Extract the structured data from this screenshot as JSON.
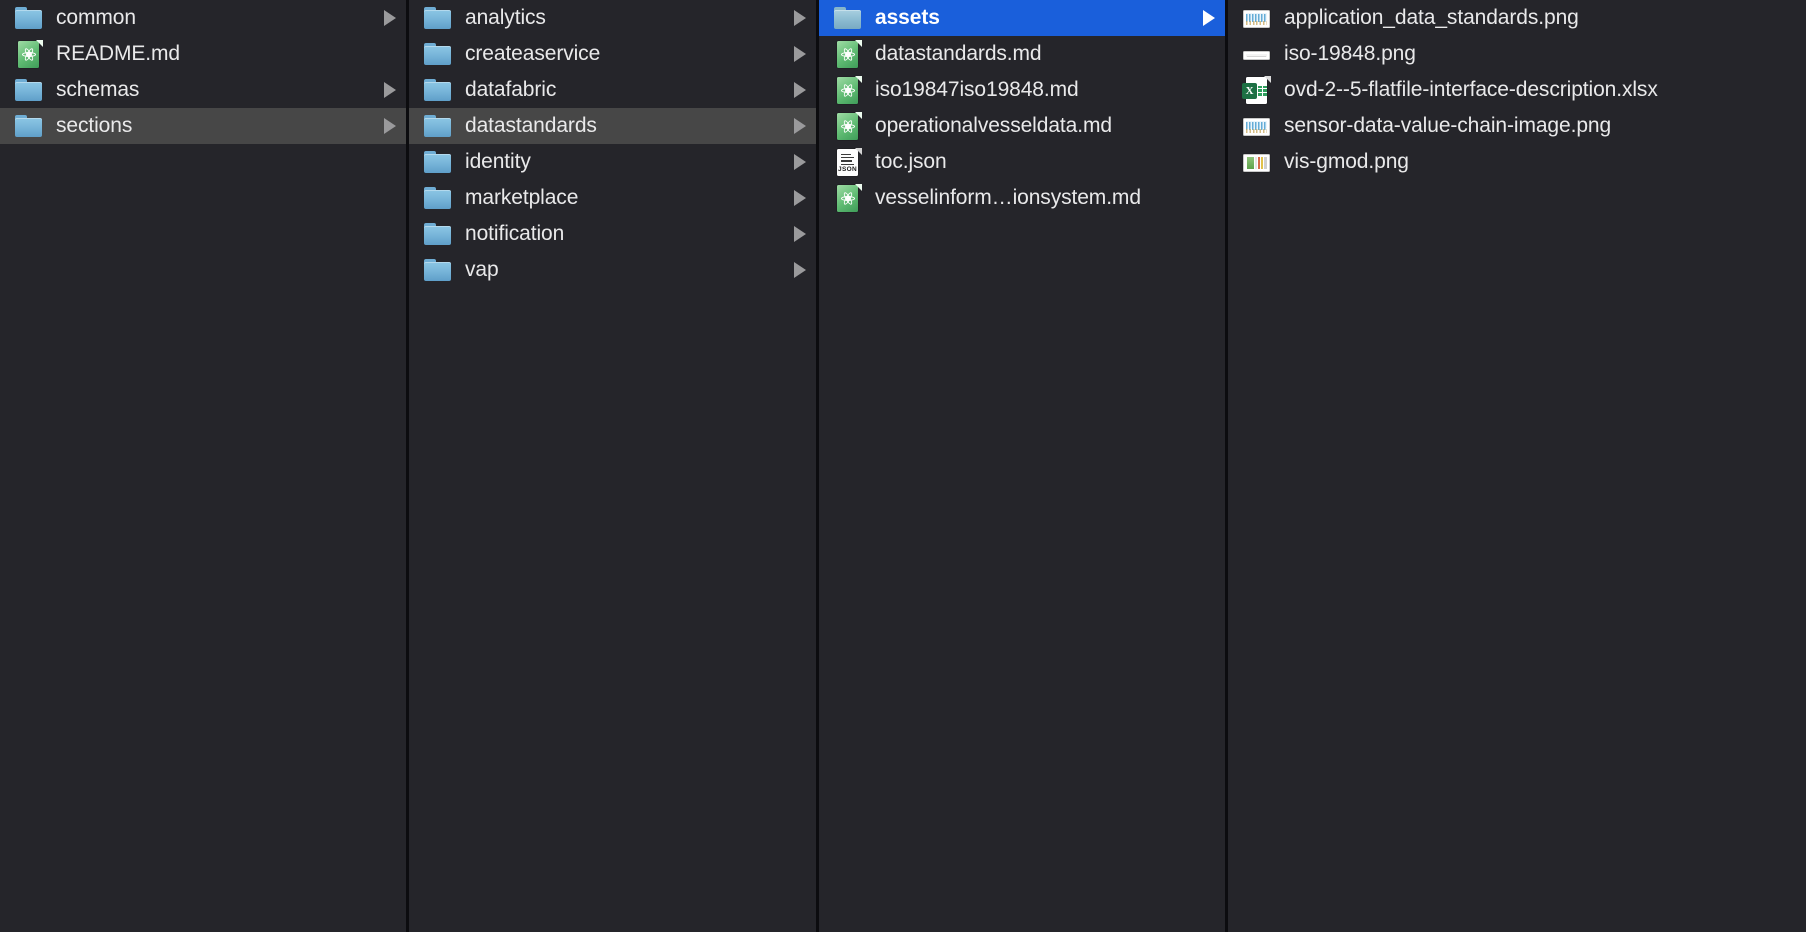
{
  "view": {
    "kind": "finder-column-view",
    "background_color": "#25252a",
    "divider_color": "#0c0c0f",
    "text_color": "#e9e9ea",
    "selection_active_color": "#1a5fdb",
    "selection_inactive_color": "#474747"
  },
  "columns": [
    {
      "name": "column-1",
      "items": [
        {
          "label": "common",
          "icon": "folder-icon",
          "has_chevron": true,
          "selected": "none"
        },
        {
          "label": "README.md",
          "icon": "markdown-icon",
          "has_chevron": false,
          "selected": "none"
        },
        {
          "label": "schemas",
          "icon": "folder-icon",
          "has_chevron": true,
          "selected": "none"
        },
        {
          "label": "sections",
          "icon": "folder-icon",
          "has_chevron": true,
          "selected": "inactive"
        }
      ]
    },
    {
      "name": "column-2",
      "items": [
        {
          "label": "analytics",
          "icon": "folder-icon",
          "has_chevron": true,
          "selected": "none"
        },
        {
          "label": "createaservice",
          "icon": "folder-icon",
          "has_chevron": true,
          "selected": "none"
        },
        {
          "label": "datafabric",
          "icon": "folder-icon",
          "has_chevron": true,
          "selected": "none"
        },
        {
          "label": "datastandards",
          "icon": "folder-icon",
          "has_chevron": true,
          "selected": "inactive"
        },
        {
          "label": "identity",
          "icon": "folder-icon",
          "has_chevron": true,
          "selected": "none"
        },
        {
          "label": "marketplace",
          "icon": "folder-icon",
          "has_chevron": true,
          "selected": "none"
        },
        {
          "label": "notification",
          "icon": "folder-icon",
          "has_chevron": true,
          "selected": "none"
        },
        {
          "label": "vap",
          "icon": "folder-icon",
          "has_chevron": true,
          "selected": "none"
        }
      ]
    },
    {
      "name": "column-3",
      "items": [
        {
          "label": "assets",
          "icon": "folder-icon",
          "has_chevron": true,
          "selected": "active"
        },
        {
          "label": "datastandards.md",
          "icon": "markdown-icon",
          "has_chevron": false,
          "selected": "none"
        },
        {
          "label": "iso19847iso19848.md",
          "icon": "markdown-icon",
          "has_chevron": false,
          "selected": "none"
        },
        {
          "label": "operationalvesseldata.md",
          "icon": "markdown-icon",
          "has_chevron": false,
          "selected": "none"
        },
        {
          "label": "toc.json",
          "icon": "json-icon",
          "has_chevron": false,
          "selected": "none"
        },
        {
          "label": "vesselinform…ionsystem.md",
          "icon": "markdown-icon",
          "has_chevron": false,
          "selected": "none"
        }
      ]
    },
    {
      "name": "column-4",
      "items": [
        {
          "label": "application_data_standards.png",
          "icon": "png-chart-icon",
          "has_chevron": false,
          "selected": "none"
        },
        {
          "label": "iso-19848.png",
          "icon": "png-bar-icon",
          "has_chevron": false,
          "selected": "none"
        },
        {
          "label": "ovd-2--5-flatfile-interface-description.xlsx",
          "icon": "xlsx-icon",
          "has_chevron": false,
          "selected": "none"
        },
        {
          "label": "sensor-data-value-chain-image.png",
          "icon": "png-chart-icon",
          "has_chevron": false,
          "selected": "none"
        },
        {
          "label": "vis-gmod.png",
          "icon": "png-color-icon",
          "has_chevron": false,
          "selected": "none"
        }
      ]
    }
  ],
  "icon_labels": {
    "json_tag": "JSON",
    "xlsx_tag": "X"
  }
}
